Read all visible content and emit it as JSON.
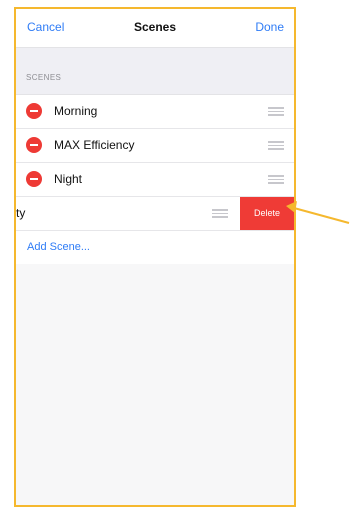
{
  "nav": {
    "cancel_label": "Cancel",
    "title": "Scenes",
    "done_label": "Done"
  },
  "section": {
    "header": "SCENES"
  },
  "scenes": [
    {
      "label": "Morning"
    },
    {
      "label": "MAX Efficiency"
    },
    {
      "label": "Night"
    }
  ],
  "swiped_row": {
    "label": "ty",
    "delete_label": "Delete"
  },
  "add_scene_label": "Add Scene...",
  "colors": {
    "accent": "#2f7cf6",
    "delete": "#ef3b36",
    "frame": "#f5b82e",
    "arrow": "#f5b82e"
  }
}
